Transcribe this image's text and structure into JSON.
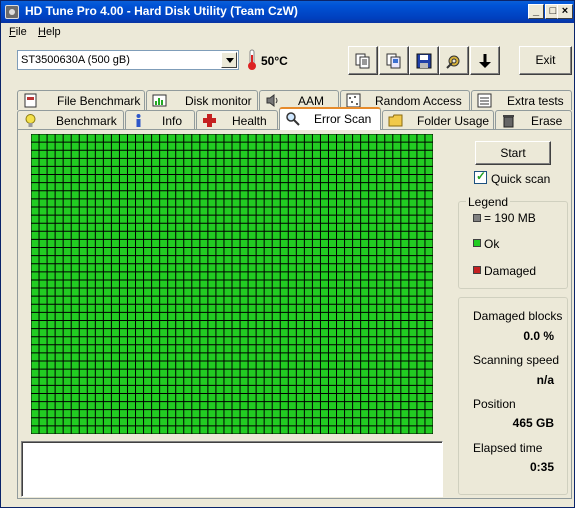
{
  "window": {
    "title": "HD Tune Pro 4.00 - Hard Disk Utility (Team CzW)",
    "controls": {
      "minimize": "_",
      "maximize": "□",
      "close": "×"
    }
  },
  "menu": {
    "file_key": "F",
    "file_rest": "ile",
    "help_key": "H",
    "help_rest": "elp"
  },
  "toolbar": {
    "drive": "ST3500630A (500 gB)",
    "temperature": "50°C",
    "buttons": [
      "copy-text-icon",
      "copy-screenshot-icon",
      "save-icon",
      "options-icon",
      "download-icon"
    ],
    "exit_label": "Exit"
  },
  "tabs_row1": [
    {
      "label": "File Benchmark",
      "icon": "file-benchmark-icon"
    },
    {
      "label": "Disk monitor",
      "icon": "disk-monitor-icon"
    },
    {
      "label": "AAM",
      "icon": "speaker-icon"
    },
    {
      "label": "Random Access",
      "icon": "random-access-icon"
    },
    {
      "label": "Extra tests",
      "icon": "extra-tests-icon"
    }
  ],
  "tabs_row2": [
    {
      "label": "Benchmark",
      "icon": "lightbulb-icon"
    },
    {
      "label": "Info",
      "icon": "info-icon"
    },
    {
      "label": "Health",
      "icon": "health-cross-icon"
    },
    {
      "label": "Error Scan",
      "icon": "magnifier-icon",
      "active": true
    },
    {
      "label": "Folder Usage",
      "icon": "folder-icon"
    },
    {
      "label": "Erase",
      "icon": "trash-icon"
    }
  ],
  "scan": {
    "start_label": "Start",
    "quick_scan_label": "Quick scan",
    "quick_scan_checked": true,
    "block_state": "ok",
    "colors": {
      "ok": "#22cc22",
      "damaged": "#c42020",
      "unit": "#808080",
      "grid_line": "#000000"
    }
  },
  "legend": {
    "title": "Legend",
    "items": [
      {
        "label": "= 190 MB",
        "color": "#808080"
      },
      {
        "label": "Ok",
        "color": "#22cc22"
      },
      {
        "label": "Damaged",
        "color": "#c42020"
      }
    ]
  },
  "stats": {
    "damaged_blocks_label": "Damaged blocks",
    "damaged_blocks_value": "0.0 %",
    "scanning_speed_label": "Scanning speed",
    "scanning_speed_value": "n/a",
    "position_label": "Position",
    "position_value": "465 GB",
    "elapsed_label": "Elapsed time",
    "elapsed_value": "0:35"
  }
}
